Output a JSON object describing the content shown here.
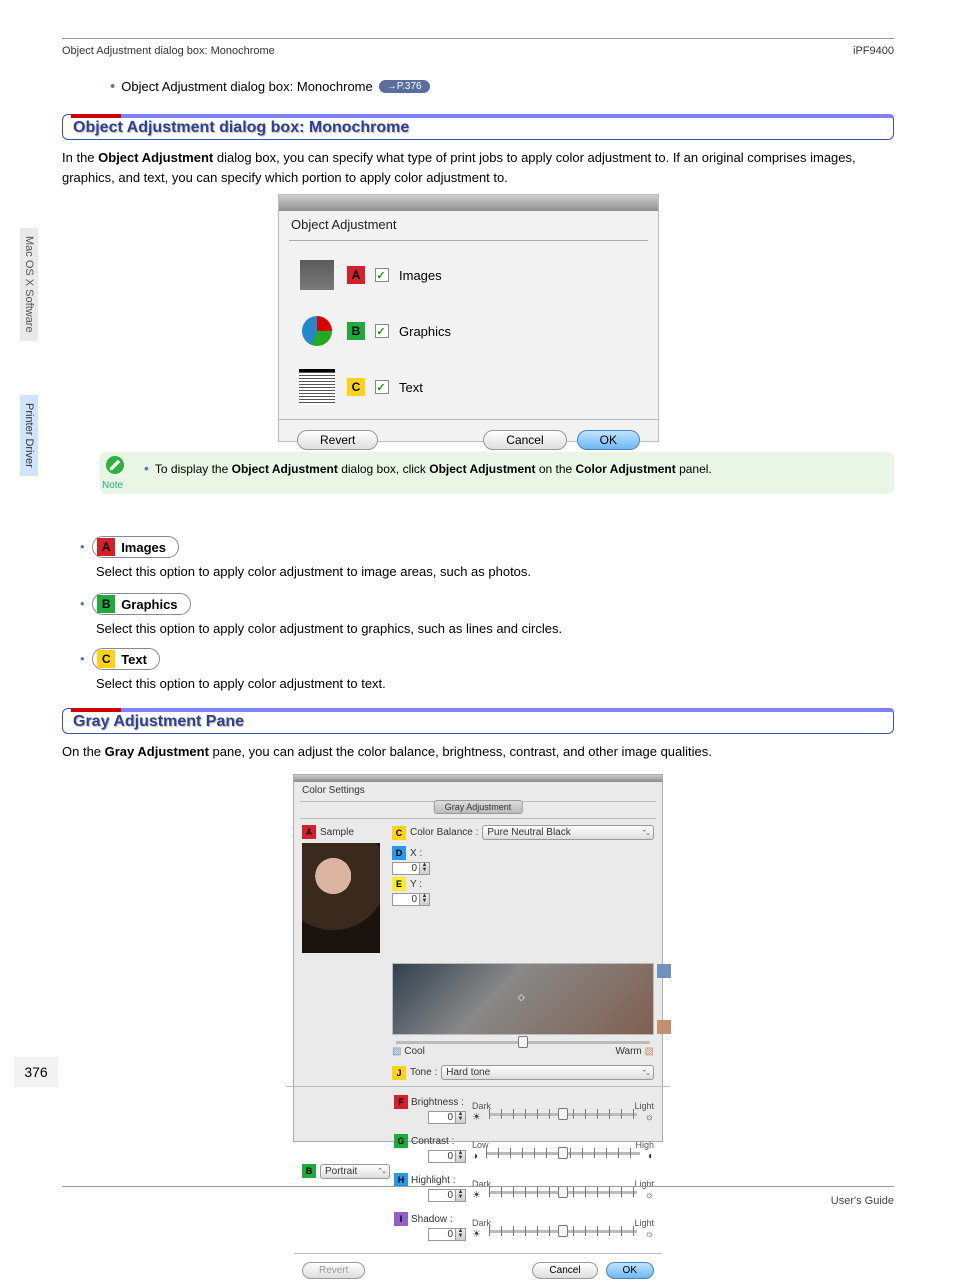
{
  "header": {
    "breadcrumb": "Object Adjustment dialog box: Monochrome",
    "model": "iPF9400"
  },
  "link_line": {
    "text": "Object Adjustment dialog box: Monochrome",
    "ref": "→P.376"
  },
  "section1": {
    "title": "Object Adjustment dialog box: Monochrome",
    "para_pre": "In the ",
    "para_bold1": "Object Adjustment",
    "para_post": " dialog box, you can specify what type of print jobs to apply color adjustment to. If an original comprises images, graphics, and text, you can specify which portion to apply color adjustment to."
  },
  "dlg1": {
    "title": "Object Adjustment",
    "rows": [
      {
        "badge": "A",
        "label": "Images"
      },
      {
        "badge": "B",
        "label": "Graphics"
      },
      {
        "badge": "C",
        "label": "Text"
      }
    ],
    "buttons": {
      "revert": "Revert",
      "cancel": "Cancel",
      "ok": "OK"
    }
  },
  "note": {
    "pre": "To display the ",
    "b1": "Object Adjustment",
    "mid": " dialog box, click ",
    "b2": "Object Adjustment",
    "mid2": " on the ",
    "b3": "Color Adjustment",
    "post": " panel.",
    "label": "Note"
  },
  "cats": [
    {
      "badge": "A",
      "label": "Images",
      "desc": "Select this option to apply color adjustment to image areas, such as photos."
    },
    {
      "badge": "B",
      "label": "Graphics",
      "desc": "Select this option to apply color adjustment to graphics, such as lines and circles."
    },
    {
      "badge": "C",
      "label": "Text",
      "desc": "Select this option to apply color adjustment to text."
    }
  ],
  "section2": {
    "title": "Gray Adjustment Pane",
    "para_pre": "On the ",
    "para_bold1": "Gray Adjustment",
    "para_post": " pane, you can adjust the color balance, brightness, contrast, and other image qualities."
  },
  "dlg2": {
    "window_title": "Color Settings",
    "tab": "Gray Adjustment",
    "sample_badge": "A",
    "sample_label": "Sample",
    "orient_badge": "B",
    "orient_label": "Portrait",
    "color_balance_badge": "C",
    "color_balance_label": "Color Balance :",
    "color_balance_value": "Pure Neutral Black",
    "x_badge": "D",
    "x_label": "X :",
    "x_value": "0",
    "y_badge": "E",
    "y_label": "Y :",
    "y_value": "0",
    "tone_badge": "J",
    "tone_label": "Tone :",
    "tone_value": "Hard tone",
    "cool": "Cool",
    "warm": "Warm",
    "sliders": [
      {
        "badge": "F",
        "label": "Brightness :",
        "value": "0",
        "low": "Dark",
        "lowIco": "☀",
        "high": "Light",
        "highIco": "☼"
      },
      {
        "badge": "G",
        "label": "Contrast :",
        "value": "0",
        "low": "Low",
        "lowIco": "◑",
        "high": "High",
        "highIco": "◐"
      },
      {
        "badge": "H",
        "label": "Highlight :",
        "value": "0",
        "low": "Dark",
        "lowIco": "☀",
        "high": "Light",
        "highIco": "☼"
      },
      {
        "badge": "I",
        "label": "Shadow :",
        "value": "0",
        "low": "Dark",
        "lowIco": "☀",
        "high": "Light",
        "highIco": "☼"
      }
    ],
    "buttons": {
      "revert": "Revert",
      "cancel": "Cancel",
      "ok": "OK"
    }
  },
  "sidetabs": {
    "t1": "Mac OS X Software",
    "t2": "Printer Driver"
  },
  "page_number": "376",
  "footer_label": "User's Guide"
}
